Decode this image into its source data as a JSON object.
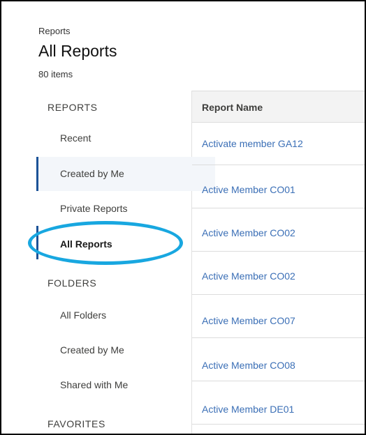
{
  "header": {
    "breadcrumb": "Reports",
    "title": "All Reports",
    "count": "80 items"
  },
  "sidebar": {
    "reports_section": "REPORTS",
    "report_items": [
      "Recent",
      "Created by Me",
      "Private Reports",
      "All Reports"
    ],
    "folders_section": "FOLDERS",
    "folder_items": [
      "All Folders",
      "Created by Me",
      "Shared with Me"
    ],
    "favorites_section": "FAVORITES"
  },
  "table": {
    "column": "Report Name",
    "rows": [
      "Activate member GA12",
      "Active Member CO01",
      "Active Member CO02",
      "Active Member CO02",
      "Active Member CO07",
      "Active Member CO08",
      "Active Member DE01"
    ]
  },
  "colors": {
    "link": "#3b6fb6",
    "accent": "#1b5297",
    "highlight": "#18a7e0"
  }
}
